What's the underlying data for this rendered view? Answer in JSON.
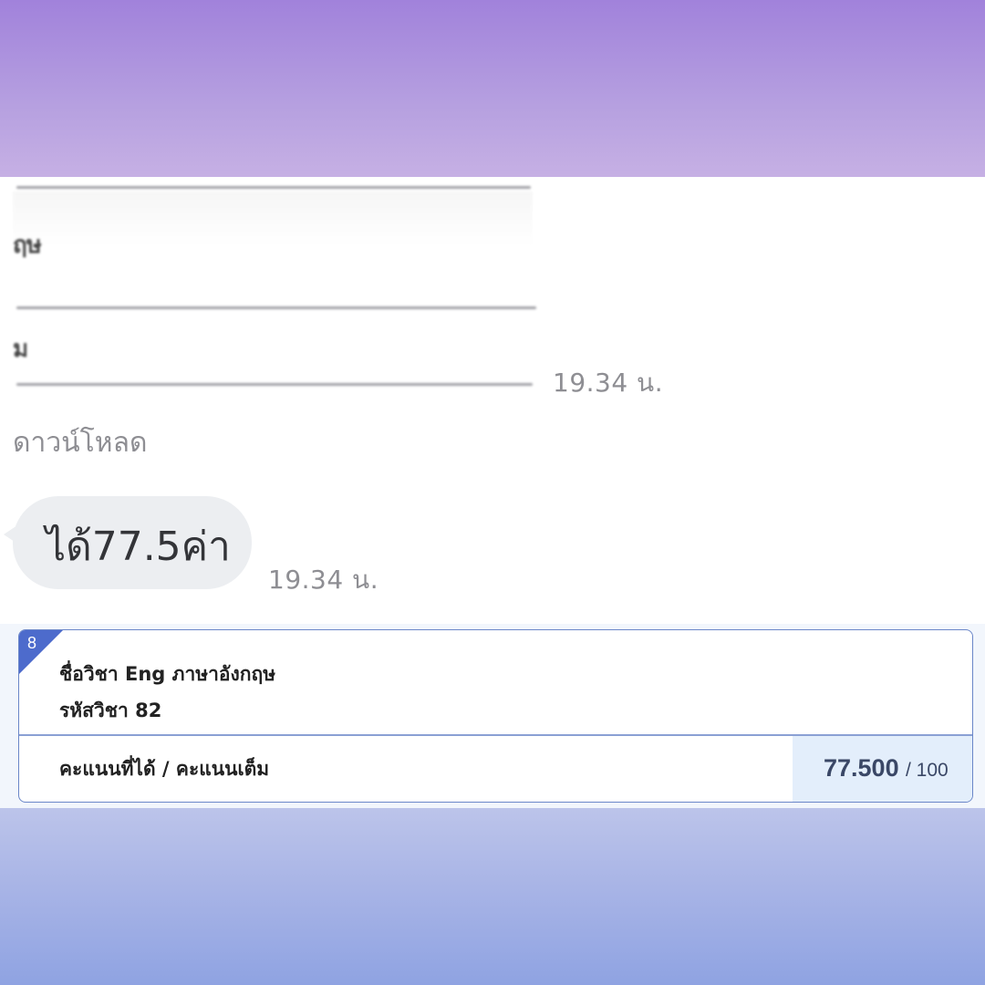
{
  "colors": {
    "top_banner": "#a182db",
    "bottom_banner": "#8fa3e2",
    "bubble": "#eceef1",
    "card_border": "#6a86c8",
    "corner_badge": "#4d6bcc",
    "score_box": "#e3eefb"
  },
  "chat": {
    "file_preview": {
      "row1": "ฤษ",
      "row2": "ม"
    },
    "file_timestamp": "19.34 น.",
    "download_label": "ดาวน์โหลด",
    "message_text": "ได้77.5ค่า",
    "message_timestamp": "19.34 น."
  },
  "grade_card": {
    "index": "8",
    "subject_name": "ชื่อวิชา Eng ภาษาอังกฤษ",
    "subject_code": "รหัสวิชา 82",
    "score_label": "คะแนนที่ได้ / คะแนนเต็ม",
    "score_value": "77.500",
    "score_max": "/ 100"
  }
}
